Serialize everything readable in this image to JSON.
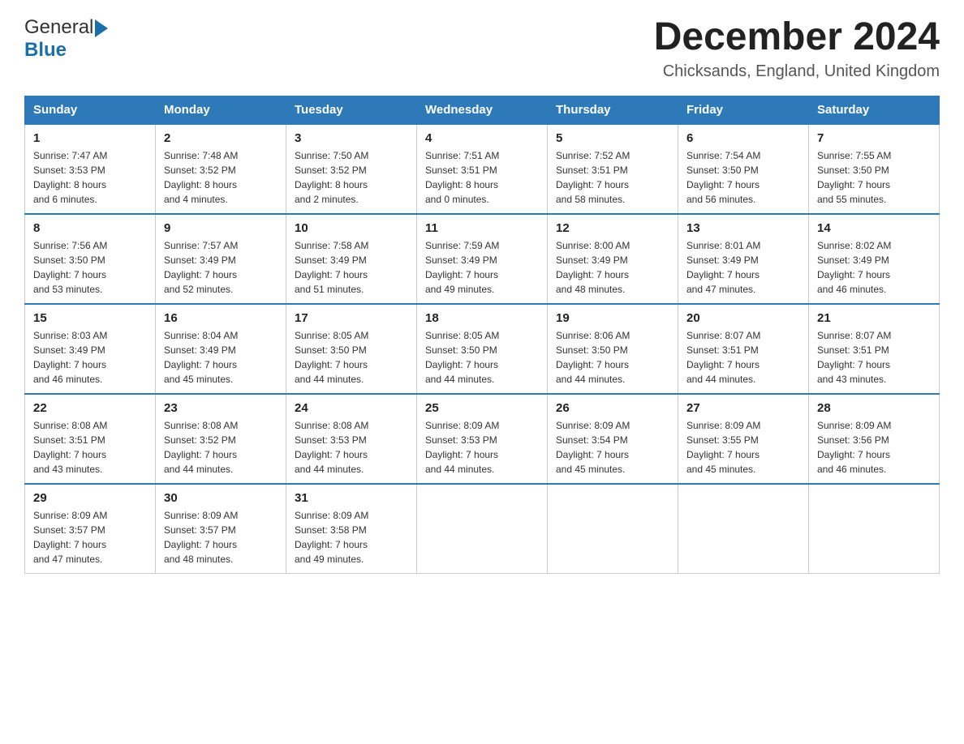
{
  "header": {
    "logo_general": "General",
    "logo_blue": "Blue",
    "month_title": "December 2024",
    "location": "Chicksands, England, United Kingdom"
  },
  "days_of_week": [
    "Sunday",
    "Monday",
    "Tuesday",
    "Wednesday",
    "Thursday",
    "Friday",
    "Saturday"
  ],
  "weeks": [
    [
      {
        "day": "1",
        "sunrise": "7:47 AM",
        "sunset": "3:53 PM",
        "daylight": "8 hours and 6 minutes."
      },
      {
        "day": "2",
        "sunrise": "7:48 AM",
        "sunset": "3:52 PM",
        "daylight": "8 hours and 4 minutes."
      },
      {
        "day": "3",
        "sunrise": "7:50 AM",
        "sunset": "3:52 PM",
        "daylight": "8 hours and 2 minutes."
      },
      {
        "day": "4",
        "sunrise": "7:51 AM",
        "sunset": "3:51 PM",
        "daylight": "8 hours and 0 minutes."
      },
      {
        "day": "5",
        "sunrise": "7:52 AM",
        "sunset": "3:51 PM",
        "daylight": "7 hours and 58 minutes."
      },
      {
        "day": "6",
        "sunrise": "7:54 AM",
        "sunset": "3:50 PM",
        "daylight": "7 hours and 56 minutes."
      },
      {
        "day": "7",
        "sunrise": "7:55 AM",
        "sunset": "3:50 PM",
        "daylight": "7 hours and 55 minutes."
      }
    ],
    [
      {
        "day": "8",
        "sunrise": "7:56 AM",
        "sunset": "3:50 PM",
        "daylight": "7 hours and 53 minutes."
      },
      {
        "day": "9",
        "sunrise": "7:57 AM",
        "sunset": "3:49 PM",
        "daylight": "7 hours and 52 minutes."
      },
      {
        "day": "10",
        "sunrise": "7:58 AM",
        "sunset": "3:49 PM",
        "daylight": "7 hours and 51 minutes."
      },
      {
        "day": "11",
        "sunrise": "7:59 AM",
        "sunset": "3:49 PM",
        "daylight": "7 hours and 49 minutes."
      },
      {
        "day": "12",
        "sunrise": "8:00 AM",
        "sunset": "3:49 PM",
        "daylight": "7 hours and 48 minutes."
      },
      {
        "day": "13",
        "sunrise": "8:01 AM",
        "sunset": "3:49 PM",
        "daylight": "7 hours and 47 minutes."
      },
      {
        "day": "14",
        "sunrise": "8:02 AM",
        "sunset": "3:49 PM",
        "daylight": "7 hours and 46 minutes."
      }
    ],
    [
      {
        "day": "15",
        "sunrise": "8:03 AM",
        "sunset": "3:49 PM",
        "daylight": "7 hours and 46 minutes."
      },
      {
        "day": "16",
        "sunrise": "8:04 AM",
        "sunset": "3:49 PM",
        "daylight": "7 hours and 45 minutes."
      },
      {
        "day": "17",
        "sunrise": "8:05 AM",
        "sunset": "3:50 PM",
        "daylight": "7 hours and 44 minutes."
      },
      {
        "day": "18",
        "sunrise": "8:05 AM",
        "sunset": "3:50 PM",
        "daylight": "7 hours and 44 minutes."
      },
      {
        "day": "19",
        "sunrise": "8:06 AM",
        "sunset": "3:50 PM",
        "daylight": "7 hours and 44 minutes."
      },
      {
        "day": "20",
        "sunrise": "8:07 AM",
        "sunset": "3:51 PM",
        "daylight": "7 hours and 44 minutes."
      },
      {
        "day": "21",
        "sunrise": "8:07 AM",
        "sunset": "3:51 PM",
        "daylight": "7 hours and 43 minutes."
      }
    ],
    [
      {
        "day": "22",
        "sunrise": "8:08 AM",
        "sunset": "3:51 PM",
        "daylight": "7 hours and 43 minutes."
      },
      {
        "day": "23",
        "sunrise": "8:08 AM",
        "sunset": "3:52 PM",
        "daylight": "7 hours and 44 minutes."
      },
      {
        "day": "24",
        "sunrise": "8:08 AM",
        "sunset": "3:53 PM",
        "daylight": "7 hours and 44 minutes."
      },
      {
        "day": "25",
        "sunrise": "8:09 AM",
        "sunset": "3:53 PM",
        "daylight": "7 hours and 44 minutes."
      },
      {
        "day": "26",
        "sunrise": "8:09 AM",
        "sunset": "3:54 PM",
        "daylight": "7 hours and 45 minutes."
      },
      {
        "day": "27",
        "sunrise": "8:09 AM",
        "sunset": "3:55 PM",
        "daylight": "7 hours and 45 minutes."
      },
      {
        "day": "28",
        "sunrise": "8:09 AM",
        "sunset": "3:56 PM",
        "daylight": "7 hours and 46 minutes."
      }
    ],
    [
      {
        "day": "29",
        "sunrise": "8:09 AM",
        "sunset": "3:57 PM",
        "daylight": "7 hours and 47 minutes."
      },
      {
        "day": "30",
        "sunrise": "8:09 AM",
        "sunset": "3:57 PM",
        "daylight": "7 hours and 48 minutes."
      },
      {
        "day": "31",
        "sunrise": "8:09 AM",
        "sunset": "3:58 PM",
        "daylight": "7 hours and 49 minutes."
      },
      null,
      null,
      null,
      null
    ]
  ],
  "labels": {
    "sunrise": "Sunrise:",
    "sunset": "Sunset:",
    "daylight": "Daylight:"
  }
}
